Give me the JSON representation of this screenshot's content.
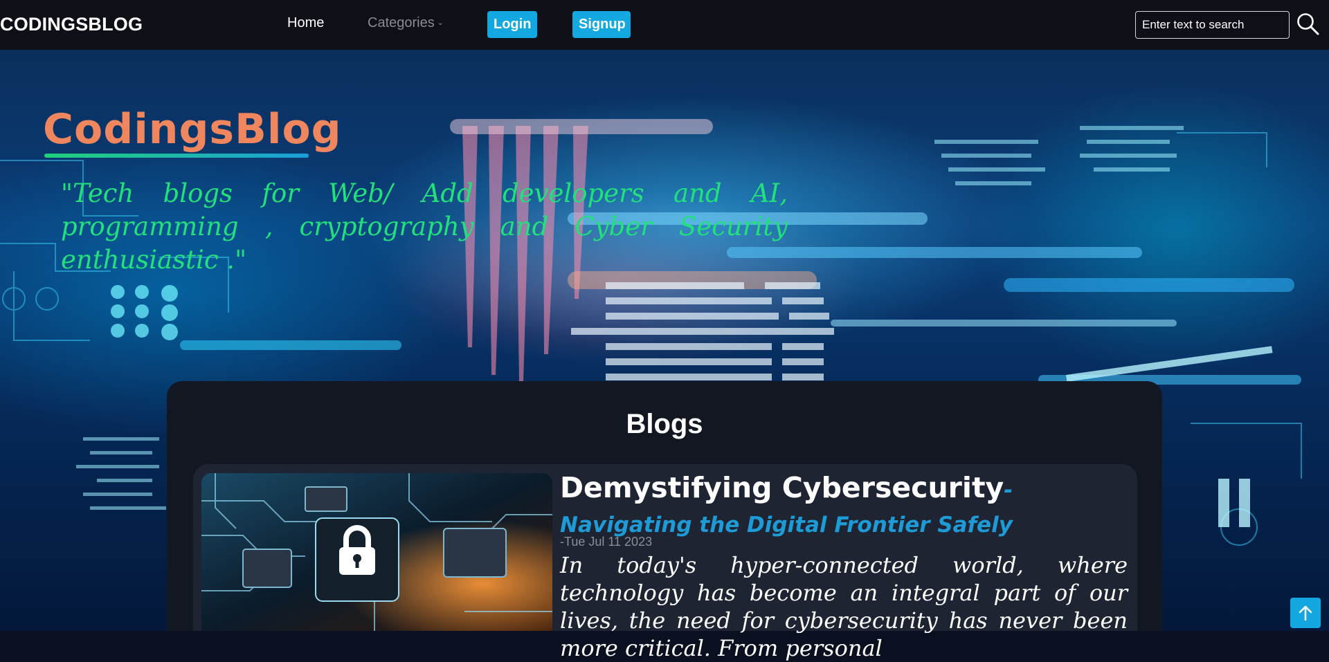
{
  "nav": {
    "brand": "CODINGSBLOG",
    "home": "Home",
    "categories": "Categories",
    "login": "Login",
    "signup": "Signup",
    "search_placeholder": "Enter text to search"
  },
  "hero": {
    "title": "CodingsBlog",
    "tagline": "\"Tech blogs for Web/ Add developers and AI, programming , cryptography and Cyber Security enthusiastic .\""
  },
  "blogs": {
    "heading": "Blogs",
    "items": [
      {
        "title": "Demystifying Cybersecurity",
        "subtitle": "-Navigating the Digital Frontier Safely",
        "date": "-Tue Jul 11 2023",
        "excerpt": "In today's hyper-connected world, where technology has become an integral part of our lives, the need for cybersecurity has never been more critical. From personal"
      }
    ]
  },
  "colors": {
    "accent": "#14a8e0",
    "hero_title": "#f0865e",
    "tagline": "#22e07c",
    "subtitle": "#1e9bd6"
  },
  "icons": [
    "search-icon",
    "chevron-down-icon",
    "arrow-up-icon",
    "lock-icon"
  ]
}
